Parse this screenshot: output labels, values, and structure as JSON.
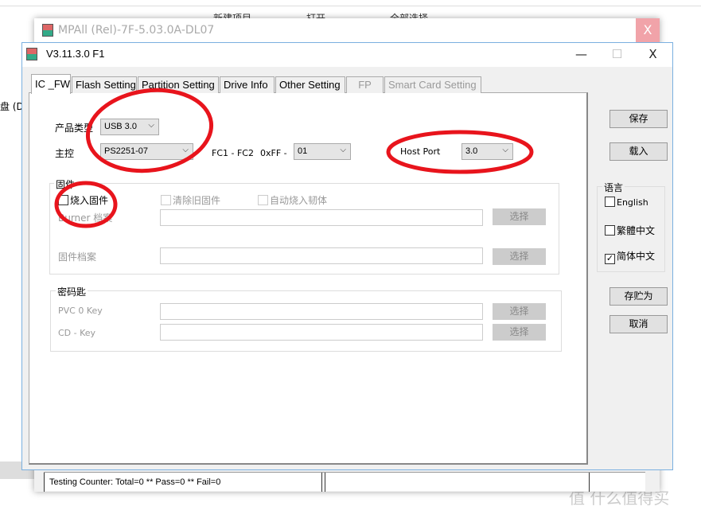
{
  "background": {
    "ribbon_items": [
      "新建项目",
      "打开",
      "全部选择"
    ],
    "drive_label": "盘 (D",
    "watermark": "值 什么值得买"
  },
  "outer_window": {
    "title": "MPAll (Rel)-7F-5.03.0A-DL07",
    "close": "X",
    "status": {
      "counter": "Testing Counter: Total=0 ** Pass=0 ** Fail=0"
    }
  },
  "dialog": {
    "title": "V3.11.3.0 F1",
    "controls": {
      "minimize": "—",
      "maximize": "☐",
      "close": "X"
    },
    "tabs": [
      {
        "label": "IC _FW",
        "active": true
      },
      {
        "label": "Flash Setting"
      },
      {
        "label": "Partition Setting"
      },
      {
        "label": "Drive Info"
      },
      {
        "label": "Other Setting"
      },
      {
        "label": "FP",
        "disabled": true
      },
      {
        "label": "Smart Card Setting",
        "disabled": true
      }
    ],
    "ic_fw": {
      "product_type_label": "产品类型",
      "product_type_value": "USB 3.0",
      "controller_label": "主控",
      "controller_value": "PS2251-07",
      "fc_label": "FC1 - FC2",
      "oxff_label": "0xFF -",
      "fc_value": "01",
      "host_port_label": "Host Port",
      "host_port_value": "3.0",
      "firmware_group": {
        "title": "固件",
        "burn_fw": {
          "label": "烧入固件",
          "checked": false
        },
        "erase_old": {
          "label": "清除旧固件",
          "checked": false
        },
        "auto_burn": {
          "label": "自动烧入韧体",
          "checked": false
        },
        "burner_label": "Burner 档案",
        "fw_file_label": "固件档案",
        "select": "选择"
      },
      "key_group": {
        "title": "密码匙",
        "pvc_label": "PVC 0 Key",
        "cd_label": "CD - Key",
        "select": "选择"
      }
    },
    "right": {
      "save": "保存",
      "load": "载入",
      "language": {
        "title": "语言",
        "options": [
          {
            "label": "English",
            "checked": false
          },
          {
            "label": "繁體中文",
            "checked": false
          },
          {
            "label": "简体中文",
            "checked": true
          }
        ]
      },
      "save_as": "存贮为",
      "cancel": "取消"
    },
    "annotation_color": "#e8141c"
  }
}
